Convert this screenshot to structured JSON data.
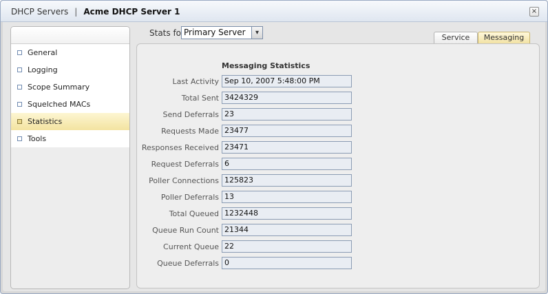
{
  "titlebar": {
    "breadcrumb": "DHCP Servers",
    "separator": "|",
    "current": "Acme DHCP Server 1",
    "close_glyph": "×"
  },
  "sidebar": {
    "items": [
      {
        "label": "General",
        "active": false
      },
      {
        "label": "Logging",
        "active": false
      },
      {
        "label": "Scope Summary",
        "active": false
      },
      {
        "label": "Squelched MACs",
        "active": false
      },
      {
        "label": "Statistics",
        "active": true
      },
      {
        "label": "Tools",
        "active": false
      }
    ]
  },
  "stats_for": {
    "label": "Stats for",
    "selected": "Primary Server",
    "arrow_glyph": "▾"
  },
  "tabs": [
    {
      "label": "Service",
      "active": false
    },
    {
      "label": "Messaging",
      "active": true
    }
  ],
  "messaging": {
    "title": "Messaging Statistics",
    "rows": [
      {
        "label": "Last Activity",
        "value": "Sep 10, 2007 5:48:00 PM"
      },
      {
        "label": "Total Sent",
        "value": "3424329"
      },
      {
        "label": "Send Deferrals",
        "value": "23"
      },
      {
        "label": "Requests Made",
        "value": "23477"
      },
      {
        "label": "Responses Received",
        "value": "23471"
      },
      {
        "label": "Request Deferrals",
        "value": "6"
      },
      {
        "label": "Poller Connections",
        "value": "125823"
      },
      {
        "label": "Poller Deferrals",
        "value": "13"
      },
      {
        "label": "Total Queued",
        "value": "1232448"
      },
      {
        "label": "Queue Run Count",
        "value": "21344"
      },
      {
        "label": "Current Queue",
        "value": "22"
      },
      {
        "label": "Queue Deferrals",
        "value": "0"
      }
    ]
  }
}
